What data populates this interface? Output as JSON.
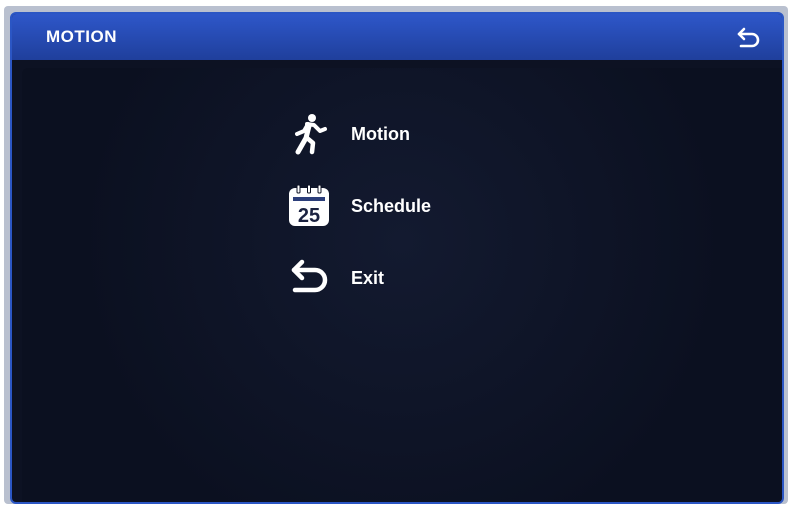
{
  "window": {
    "title": "MOTION",
    "back_icon": "back-arrow-icon"
  },
  "menu": {
    "items": [
      {
        "label": "Motion",
        "icon": "running-person-icon"
      },
      {
        "label": "Schedule",
        "icon": "calendar-icon",
        "calendar_day": "25"
      },
      {
        "label": "Exit",
        "icon": "back-arrow-icon"
      }
    ]
  },
  "colors": {
    "titlebar": "#2b56c4",
    "background": "#0d1223",
    "text": "#ffffff"
  }
}
